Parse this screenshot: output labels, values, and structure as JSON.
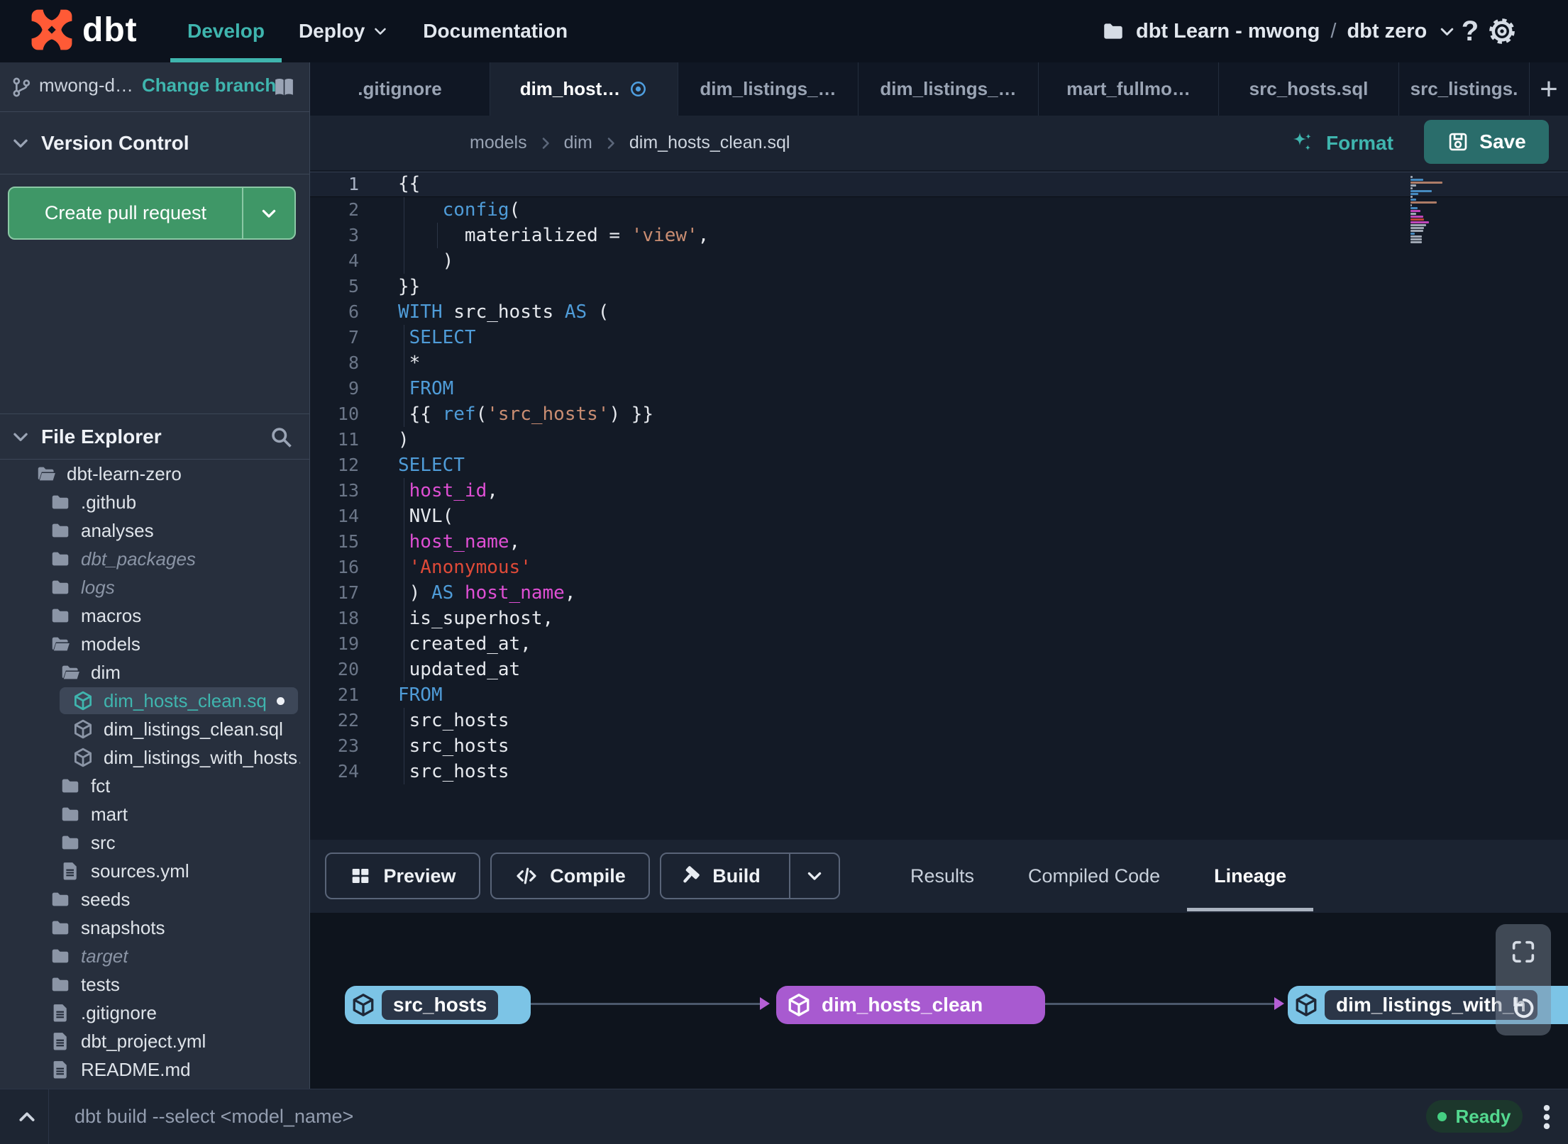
{
  "topnav": {
    "logo_text": "dbt",
    "nav_items": [
      {
        "label": "Develop",
        "active": true
      },
      {
        "label": "Deploy",
        "caret": true
      },
      {
        "label": "Documentation"
      }
    ],
    "project_label": "dbt Learn - mwong",
    "project_sep": "/",
    "env_label": "dbt zero",
    "help_label": "?"
  },
  "sidebar": {
    "branch_label": "mwong-d…",
    "change_branch_label": "Change branch",
    "version_control_title": "Version Control",
    "create_pr_label": "Create pull request",
    "file_explorer_title": "File Explorer",
    "tree": [
      {
        "label": "dbt-learn-zero",
        "type": "folder-open",
        "level": 0
      },
      {
        "label": ".github",
        "type": "folder",
        "level": 1
      },
      {
        "label": "analyses",
        "type": "folder",
        "level": 1
      },
      {
        "label": "dbt_packages",
        "type": "folder",
        "level": 1,
        "muted": true
      },
      {
        "label": "logs",
        "type": "folder",
        "level": 1,
        "muted": true
      },
      {
        "label": "macros",
        "type": "folder",
        "level": 1
      },
      {
        "label": "models",
        "type": "folder-open",
        "level": 1
      },
      {
        "label": "dim",
        "type": "folder-open",
        "level": 2
      },
      {
        "label": "dim_hosts_clean.sql",
        "type": "model",
        "level": 3,
        "selected": true,
        "dirty": true
      },
      {
        "label": "dim_listings_clean.sql",
        "type": "model",
        "level": 3
      },
      {
        "label": "dim_listings_with_hosts…",
        "type": "model",
        "level": 3
      },
      {
        "label": "fct",
        "type": "folder",
        "level": 2
      },
      {
        "label": "mart",
        "type": "folder",
        "level": 2
      },
      {
        "label": "src",
        "type": "folder",
        "level": 2
      },
      {
        "label": "sources.yml",
        "type": "file",
        "level": 2
      },
      {
        "label": "seeds",
        "type": "folder",
        "level": 1
      },
      {
        "label": "snapshots",
        "type": "folder",
        "level": 1
      },
      {
        "label": "target",
        "type": "folder",
        "level": 1,
        "muted": true
      },
      {
        "label": "tests",
        "type": "folder",
        "level": 1
      },
      {
        "label": ".gitignore",
        "type": "file",
        "level": 1
      },
      {
        "label": "dbt_project.yml",
        "type": "file",
        "level": 1
      },
      {
        "label": "README.md",
        "type": "file",
        "level": 1
      }
    ]
  },
  "tabs": {
    "items": [
      {
        "label": ".gitignore"
      },
      {
        "label": "dim_host…",
        "active": true,
        "modified": true
      },
      {
        "label": "dim_listings_…"
      },
      {
        "label": "dim_listings_…"
      },
      {
        "label": "mart_fullmo…"
      },
      {
        "label": "src_hosts.sql"
      },
      {
        "label": "src_listings."
      }
    ],
    "add_label": "+"
  },
  "breadcrumb": {
    "items": [
      "models",
      "dim",
      "dim_hosts_clean.sql"
    ]
  },
  "editor_actions": {
    "format_label": "Format",
    "save_label": "Save"
  },
  "editor": {
    "language": "sql",
    "lines": [
      {
        "segs": [
          [
            "p",
            "{{"
          ]
        ]
      },
      {
        "segs": [
          [
            "p",
            "    "
          ],
          [
            "k",
            "config"
          ],
          [
            "p",
            "("
          ]
        ]
      },
      {
        "segs": [
          [
            "p",
            "      materialized = "
          ],
          [
            "s",
            "'view'"
          ],
          [
            "p",
            ","
          ]
        ]
      },
      {
        "segs": [
          [
            "p",
            "    )"
          ]
        ]
      },
      {
        "segs": [
          [
            "p",
            "}}"
          ]
        ]
      },
      {
        "segs": [
          [
            "k",
            "WITH"
          ],
          [
            "p",
            " src_hosts "
          ],
          [
            "k",
            "AS"
          ],
          [
            "p",
            " ("
          ]
        ]
      },
      {
        "segs": [
          [
            "p",
            " "
          ],
          [
            "k",
            "SELECT"
          ]
        ]
      },
      {
        "segs": [
          [
            "p",
            " *"
          ]
        ]
      },
      {
        "segs": [
          [
            "p",
            " "
          ],
          [
            "k",
            "FROM"
          ]
        ]
      },
      {
        "segs": [
          [
            "p",
            " {{ "
          ],
          [
            "k",
            "ref"
          ],
          [
            "p",
            "("
          ],
          [
            "s",
            "'src_hosts'"
          ],
          [
            "p",
            ") }}"
          ]
        ]
      },
      {
        "segs": [
          [
            "p",
            ")"
          ]
        ]
      },
      {
        "segs": [
          [
            "k",
            "SELECT"
          ]
        ]
      },
      {
        "segs": [
          [
            "p",
            " "
          ],
          [
            "m",
            "host_id"
          ],
          [
            "p",
            ","
          ]
        ]
      },
      {
        "segs": [
          [
            "p",
            " NVL("
          ]
        ]
      },
      {
        "segs": [
          [
            "p",
            " "
          ],
          [
            "m",
            "host_name"
          ],
          [
            "p",
            ","
          ]
        ]
      },
      {
        "segs": [
          [
            "p",
            " "
          ],
          [
            "r",
            "'Anonymous'"
          ]
        ]
      },
      {
        "segs": [
          [
            "p",
            " ) "
          ],
          [
            "k",
            "AS"
          ],
          [
            "p",
            " "
          ],
          [
            "m",
            "host_name"
          ],
          [
            "p",
            ","
          ]
        ]
      },
      {
        "segs": [
          [
            "p",
            " is_superhost,"
          ]
        ]
      },
      {
        "segs": [
          [
            "p",
            " created_at,"
          ]
        ]
      },
      {
        "segs": [
          [
            "p",
            " updated_at"
          ]
        ]
      },
      {
        "segs": [
          [
            "k",
            "FROM"
          ]
        ]
      },
      {
        "segs": [
          [
            "p",
            " src_hosts"
          ]
        ]
      },
      {
        "segs": [
          [
            "p",
            " src_hosts"
          ]
        ]
      },
      {
        "segs": [
          [
            "p",
            " src_hosts"
          ]
        ]
      }
    ]
  },
  "bottom": {
    "preview_label": "Preview",
    "compile_label": "Compile",
    "build_label": "Build",
    "tabs": [
      {
        "label": "Results"
      },
      {
        "label": "Compiled Code"
      },
      {
        "label": "Lineage",
        "active": true
      }
    ]
  },
  "lineage": {
    "nodes": [
      {
        "label": "src_hosts",
        "style": "blue"
      },
      {
        "label": "dim_hosts_clean",
        "style": "purple"
      },
      {
        "label": "dim_listings_with_h",
        "style": "blue"
      }
    ]
  },
  "statusbar": {
    "command": "dbt build --select <model_name>",
    "status_label": "Ready"
  },
  "colors": {
    "brand_orange": "#ff5a36",
    "accent_teal": "#3fb5ae",
    "pr_green": "#3f9767",
    "save_teal": "#2a6d6b",
    "node_blue": "#7cc4e6",
    "node_purple": "#a85ad0",
    "arrow_purple": "#b55fd6",
    "ready_green": "#53d88f",
    "modified_blue": "#4f9fe0",
    "code_keyword": "#4f9cd8",
    "code_string": "#c98d72",
    "code_string_alt": "#df4a38",
    "code_identifier": "#df4fd4"
  }
}
